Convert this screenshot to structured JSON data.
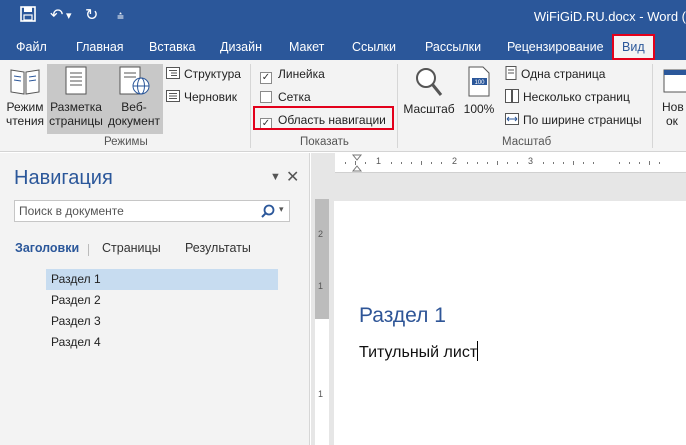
{
  "window": {
    "title": "WiFiGiD.RU.docx - Word (",
    "qat": {
      "save_icon": "floppy-disk-icon",
      "undo_glyph": "↶",
      "undo_dropdown": "▾",
      "redo_glyph": "↻",
      "customize_glyph": "⩮"
    }
  },
  "tabs": [
    {
      "label": "Файл"
    },
    {
      "label": "Главная"
    },
    {
      "label": "Вставка"
    },
    {
      "label": "Дизайн"
    },
    {
      "label": "Макет"
    },
    {
      "label": "Ссылки"
    },
    {
      "label": "Рассылки"
    },
    {
      "label": "Рецензирование"
    },
    {
      "label": "Вид",
      "active": true
    }
  ],
  "ribbon": {
    "modes": {
      "read_mode": [
        "Режим",
        "чтения"
      ],
      "print_layout": [
        "Разметка",
        "страницы"
      ],
      "web_layout": [
        "Веб-",
        "документ"
      ],
      "outline": "Структура",
      "draft": "Черновик",
      "group_label": "Режимы"
    },
    "show": {
      "ruler": {
        "label": "Линейка",
        "checked": true
      },
      "gridlines": {
        "label": "Сетка",
        "checked": false
      },
      "navigation_pane": {
        "label": "Область навигации",
        "checked": true
      },
      "group_label": "Показать"
    },
    "zoom": {
      "zoom_label": "Масштаб",
      "hundred_label": "100%",
      "one_page": "Одна страница",
      "multiple_pages": "Несколько страниц",
      "page_width": "По ширине страницы",
      "group_label": "Масштаб"
    },
    "window_group": {
      "new_window": [
        "Нов",
        "ок"
      ]
    }
  },
  "nav_pane": {
    "title": "Навигация",
    "search_placeholder": "Поиск в документе",
    "tabs": [
      "Заголовки",
      "Страницы",
      "Результаты"
    ],
    "active_tab": "Заголовки",
    "headings": [
      {
        "label": "Раздел 1",
        "selected": true
      },
      {
        "label": "Раздел 2"
      },
      {
        "label": "Раздел 3"
      },
      {
        "label": "Раздел 4"
      }
    ]
  },
  "document": {
    "heading": "Раздел 1",
    "body": "Титульный лист",
    "vruler_numbers": [
      "2",
      "1",
      "1"
    ],
    "hruler_numbers": [
      "1",
      "2",
      "3"
    ]
  },
  "colors": {
    "word_blue": "#2b579a",
    "highlight_red": "#e3001b",
    "heading_blue": "#2e5597"
  }
}
